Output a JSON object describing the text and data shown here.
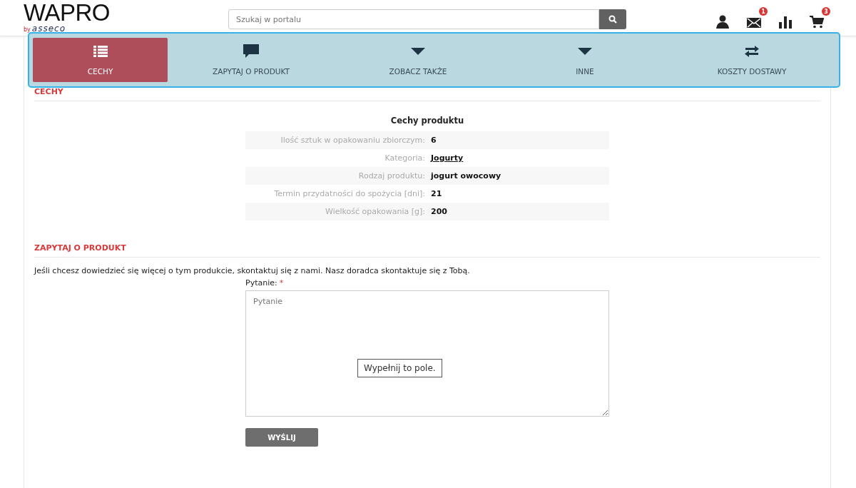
{
  "header": {
    "logo": "WAPRO",
    "logo_by": "by",
    "logo_brand": "asseco",
    "search": {
      "placeholder": "Szukaj w portalu"
    },
    "icons": [
      {
        "kind": "user"
      },
      {
        "kind": "mail",
        "badge": "1"
      },
      {
        "kind": "chart"
      },
      {
        "kind": "cart",
        "badge": "3"
      }
    ]
  },
  "tabs": [
    {
      "label": "CECHY",
      "kind": "list",
      "selected": true
    },
    {
      "label": "ZAPYTAJ O PRODUKT",
      "kind": "chat",
      "selected": false
    },
    {
      "label": "ZOBACZ TAKŻE",
      "kind": "dropdown",
      "selected": false
    },
    {
      "label": "INNE",
      "kind": "dropdown",
      "selected": false
    },
    {
      "label": "KOSZTY DOSTAWY",
      "kind": "shipping",
      "selected": false
    }
  ],
  "features": {
    "heading": "CECHY",
    "table_title": "Cechy produktu",
    "rows": [
      {
        "label": "Ilość sztuk w opakowaniu zbiorczym:",
        "value": "6",
        "link": false
      },
      {
        "label": "Kategoria:",
        "value": "Jogurty",
        "link": true
      },
      {
        "label": "Rodzaj produktu:",
        "value": "jogurt owocowy",
        "link": false
      },
      {
        "label": "Termin przydatności do spożycia [dni]:",
        "value": "21",
        "link": false
      },
      {
        "label": "Wielkość opakowania [g]:",
        "value": "200",
        "link": false
      }
    ]
  },
  "inquiry": {
    "heading": "ZAPYTAJ O PRODUKT",
    "intro": "Jeśli chcesz dowiedzieć się więcej o tym produkcie, skontaktuj się z nami. Nasz doradca skontaktuje się z Tobą.",
    "field_label": "Pytanie:",
    "required_mark": "*",
    "placeholder": "Pytanie",
    "tooltip": "Wypełnij to pole.",
    "submit": "WYŚLIJ"
  }
}
